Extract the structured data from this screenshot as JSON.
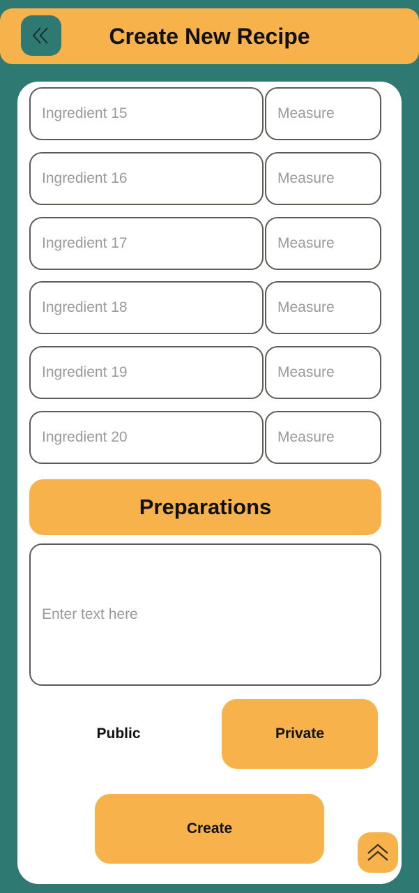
{
  "header": {
    "title": "Create New Recipe",
    "back_icon": "double-chevron-left-icon"
  },
  "ingredients": [
    {
      "placeholder": "Ingredient 15",
      "measure_placeholder": "Measure"
    },
    {
      "placeholder": "Ingredient 16",
      "measure_placeholder": "Measure"
    },
    {
      "placeholder": "Ingredient 17",
      "measure_placeholder": "Measure"
    },
    {
      "placeholder": "Ingredient 18",
      "measure_placeholder": "Measure"
    },
    {
      "placeholder": "Ingredient 19",
      "measure_placeholder": "Measure"
    },
    {
      "placeholder": "Ingredient 20",
      "measure_placeholder": "Measure"
    }
  ],
  "preparations": {
    "title": "Preparations",
    "placeholder": "Enter text here"
  },
  "visibility": {
    "public_label": "Public",
    "private_label": "Private",
    "selected": "Private"
  },
  "create_label": "Create",
  "scroll_top_icon": "double-chevron-up-icon",
  "colors": {
    "background": "#2e7a73",
    "accent": "#f8b24b",
    "card": "#ffffff",
    "border": "#5e5a55"
  }
}
